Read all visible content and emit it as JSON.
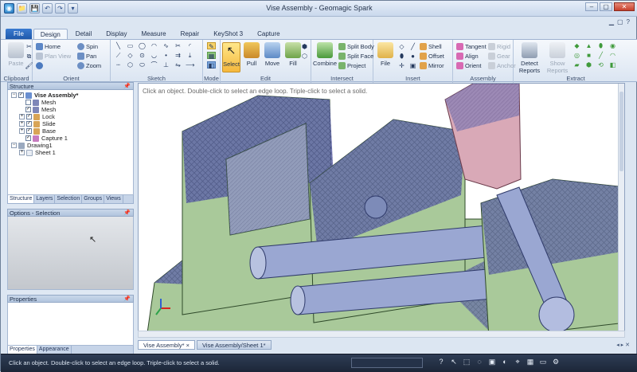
{
  "window": {
    "title": "Vise Assembly - Geomagic Spark",
    "min": "‒",
    "max": "▢",
    "close": "✕"
  },
  "quick_access": [
    "◉",
    "📁",
    "💾",
    "↶",
    "↷",
    "▾"
  ],
  "tabs": [
    "File",
    "Design",
    "Detail",
    "Display",
    "Measure",
    "Repair",
    "KeyShot 3",
    "Capture"
  ],
  "active_tab": "Design",
  "ribbon": {
    "clipboard": {
      "label": "Clipboard",
      "paste": "Paste"
    },
    "orient": {
      "label": "Orient",
      "items": [
        "Home",
        "Plan View",
        "Spin",
        "Pan",
        "Zoom"
      ]
    },
    "sketch": {
      "label": "Sketch"
    },
    "mode": {
      "label": "Mode"
    },
    "edit": {
      "label": "Edit",
      "buttons": [
        "Select",
        "Pull",
        "Move",
        "Fill"
      ]
    },
    "intersect": {
      "label": "Intersect",
      "combine": "Combine",
      "items": [
        "Split Body",
        "Split Face",
        "Project"
      ]
    },
    "insert": {
      "label": "Insert",
      "file": "File",
      "items": [
        "Shell",
        "Offset",
        "Mirror"
      ]
    },
    "assembly": {
      "label": "Assembly",
      "items": [
        "Tangent",
        "Align",
        "Orient",
        "Rigid",
        "Gear",
        "Anchor"
      ]
    },
    "extract": {
      "label": "Extract",
      "detect": "Detect Reports",
      "show": "Show Reports"
    }
  },
  "structure_panel": {
    "title": "Structure",
    "tree": [
      {
        "label": "Vise Assembly*",
        "bold": true,
        "level": 0,
        "expander": "−",
        "checked": true
      },
      {
        "label": "Mesh",
        "level": 1,
        "checked": false
      },
      {
        "label": "Mesh",
        "level": 1,
        "checked": true
      },
      {
        "label": "Lock",
        "level": 1,
        "expander": "+",
        "checked": true
      },
      {
        "label": "Slide",
        "level": 1,
        "expander": "+",
        "checked": true
      },
      {
        "label": "Base",
        "level": 1,
        "expander": "+",
        "checked": true
      },
      {
        "label": "Capture 1",
        "level": 1,
        "checked": true
      },
      {
        "label": "Drawing1",
        "level": 0,
        "expander": "−"
      },
      {
        "label": "Sheet 1",
        "level": 1,
        "expander": "+"
      }
    ],
    "tabs": [
      "Structure",
      "Layers",
      "Selection",
      "Groups",
      "Views"
    ]
  },
  "options_panel": {
    "title": "Options - Selection"
  },
  "properties_panel": {
    "title": "Properties",
    "tabs": [
      "Properties",
      "Appearance"
    ]
  },
  "viewport": {
    "hint": "Click an object. Double-click to select an edge loop. Triple-click to select a solid."
  },
  "doc_tabs": [
    "Vise Assembly*",
    "Vise Assembly/Sheet 1*"
  ],
  "status": {
    "text": "Click an object. Double-click to select an edge loop. Triple-click to select a solid."
  },
  "colors": {
    "accent": "#1c56a8",
    "model_green": "#a9c99a",
    "mesh_purple": "#5a5fa3",
    "handle_pink": "#d9a9b7"
  }
}
